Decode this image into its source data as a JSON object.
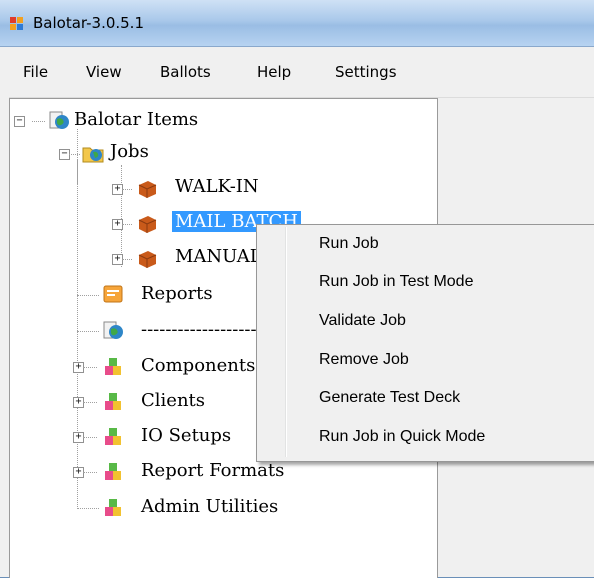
{
  "window": {
    "title": "Balotar-3.0.5.1"
  },
  "menubar": {
    "file": "File",
    "view": "View",
    "ballots": "Ballots",
    "help": "Help",
    "settings": "Settings"
  },
  "tree": {
    "root": "Balotar Items",
    "jobs": "Jobs",
    "walk_in": "WALK-IN",
    "mail_batch": "MAIL BATCH",
    "manual": "MANUAL",
    "reports": "Reports",
    "separator": "--------------------",
    "components": "Components",
    "clients": "Clients",
    "io_setups": "IO Setups",
    "report_formats": "Report Formats",
    "admin_utilities": "Admin Utilities"
  },
  "context_menu": {
    "run_job": "Run Job",
    "run_job_test": "Run Job in Test Mode",
    "validate_job": "Validate Job",
    "remove_job": "Remove Job",
    "generate_test_deck": "Generate Test Deck",
    "run_job_quick": "Run Job in Quick Mode"
  },
  "colors": {
    "selection": "#3399ff",
    "titlebar": "#a9c8ea",
    "menu_bg": "#f0f0f0"
  }
}
